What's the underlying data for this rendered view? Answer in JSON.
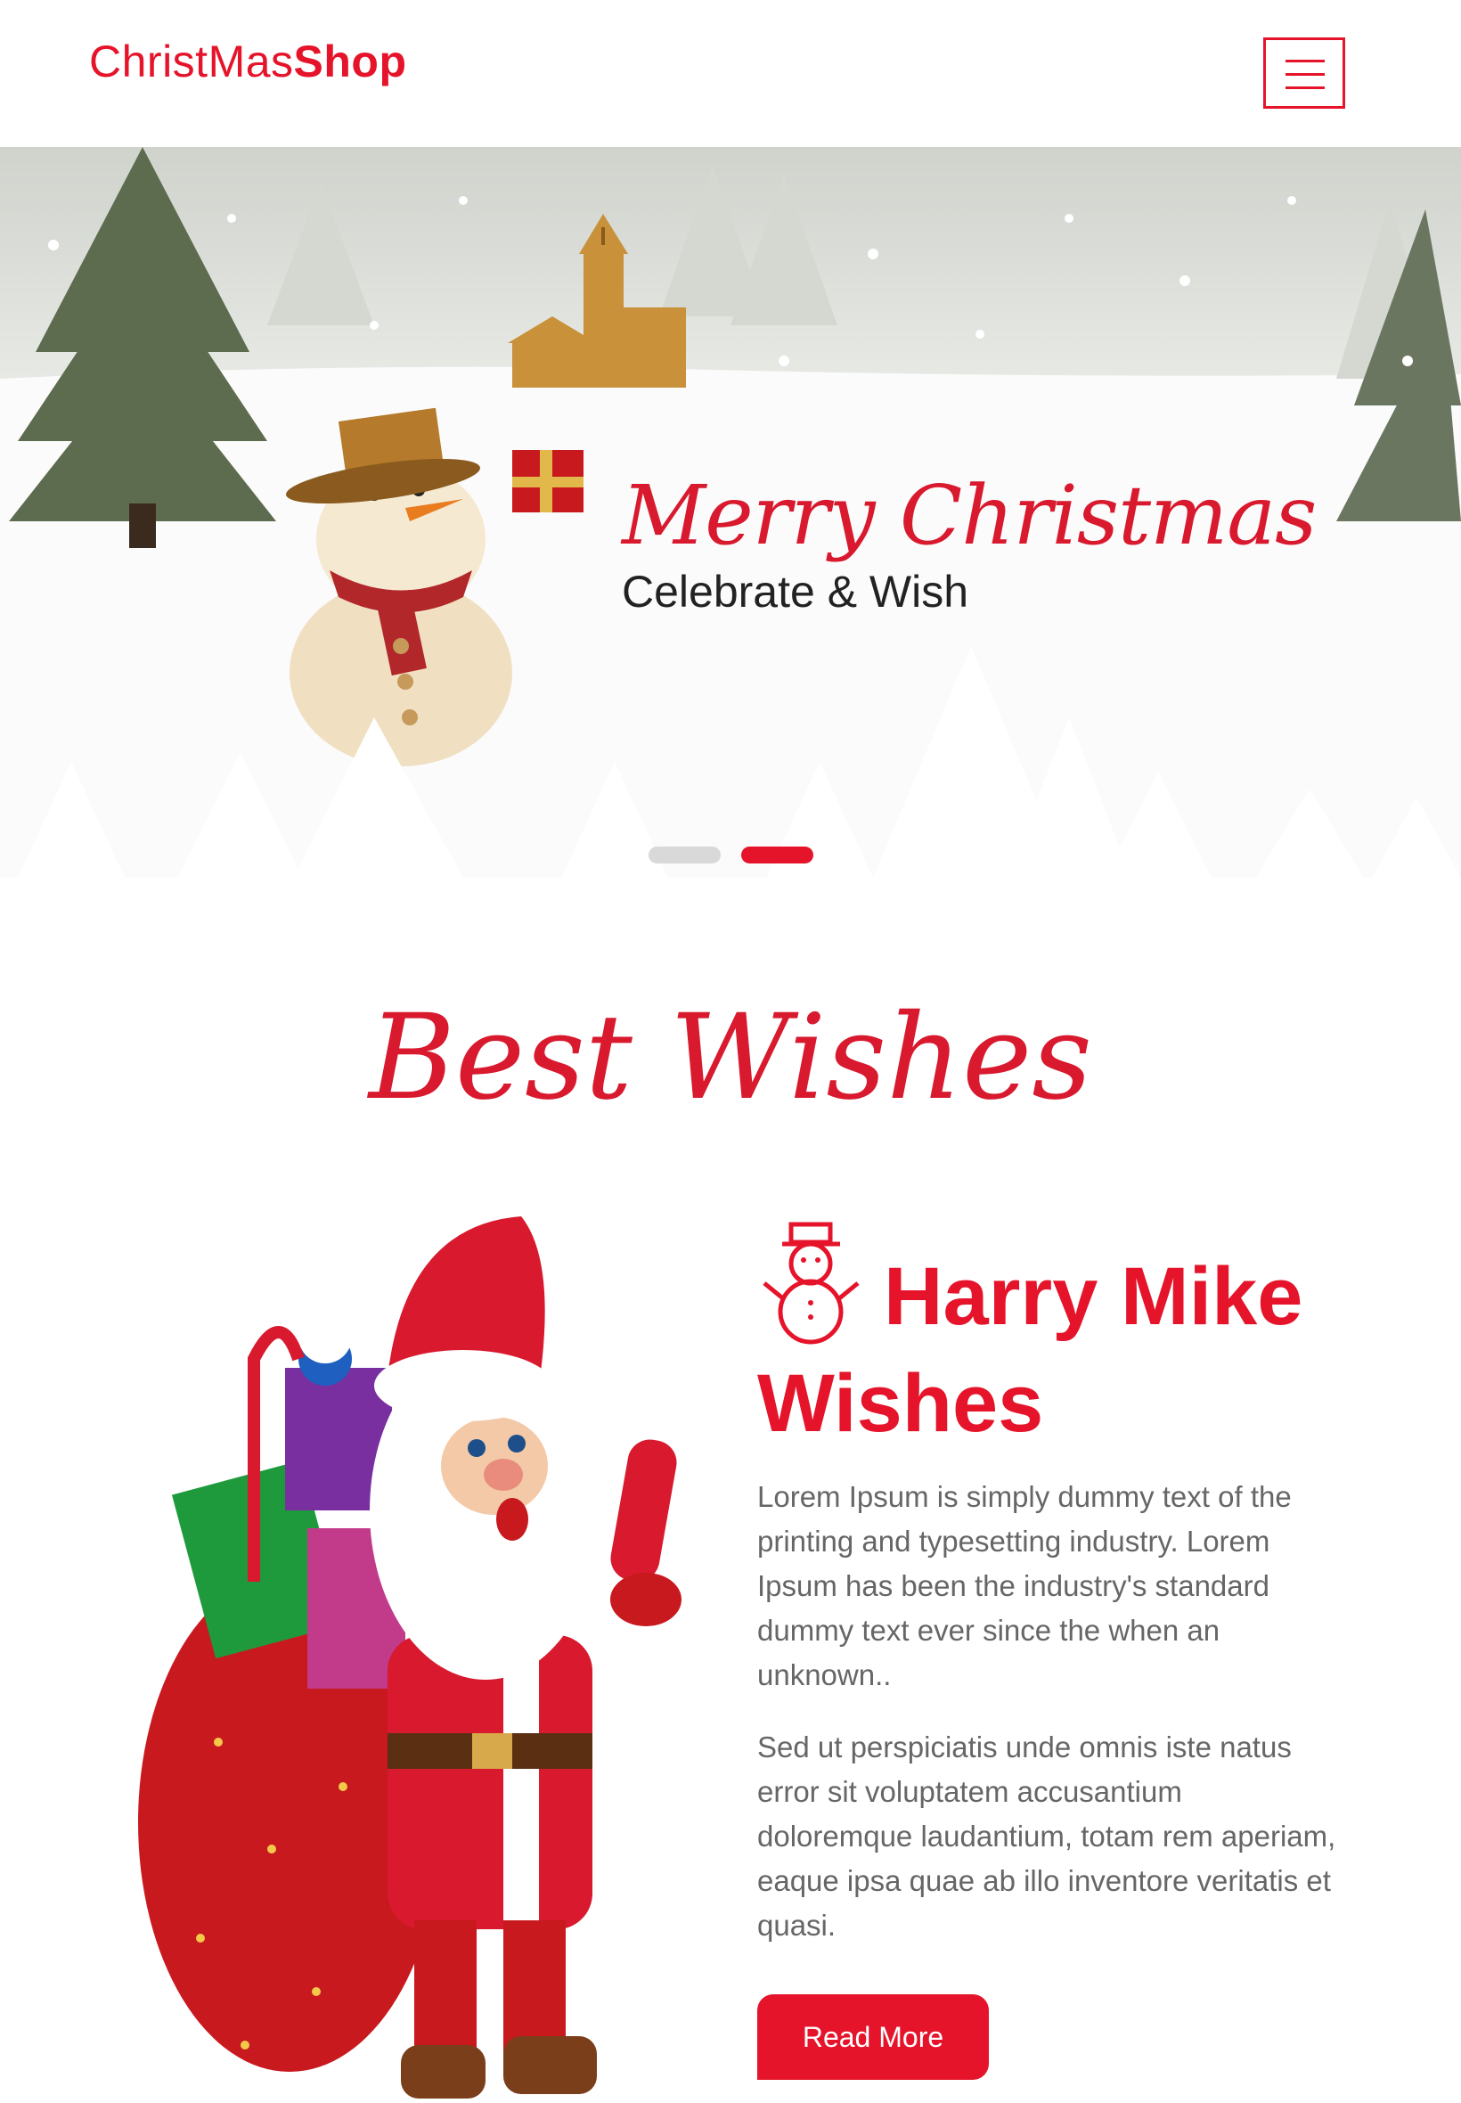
{
  "header": {
    "logo_regular": "ChristMas",
    "logo_bold": "Shop",
    "menu_icon": "hamburger-icon"
  },
  "hero": {
    "title": "Merry Christmas",
    "subtitle": "Celebrate & Wish",
    "slides_total": 2,
    "active_slide": 2
  },
  "section": {
    "title": "Best Wishes",
    "icon": "snowman-icon",
    "heading": "Harry Mike Wishes",
    "paragraph1": "Lorem Ipsum is simply dummy text of the printing and typesetting industry. Lorem Ipsum has been the industry's standard dummy text ever since the when an unknown..",
    "paragraph2": "Sed ut perspiciatis unde omnis iste natus error sit voluptatem accusantium doloremque laudantium, totam rem aperiam, eaque ipsa quae ab illo inventore veritatis et quasi.",
    "button_label": "Read More"
  },
  "colors": {
    "accent": "#e5142a",
    "text": "#666666",
    "heading_dark": "#222222"
  }
}
